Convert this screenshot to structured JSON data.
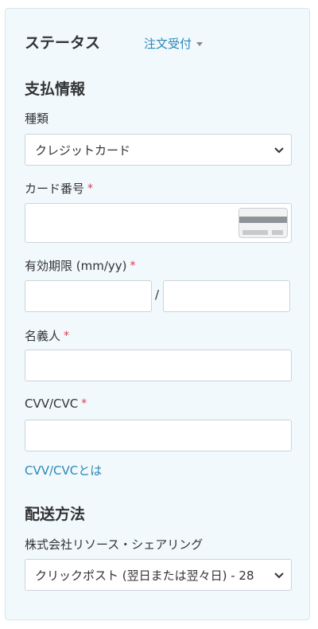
{
  "status": {
    "title": "ステータス",
    "value": "注文受付"
  },
  "payment": {
    "title": "支払情報",
    "type_label": "種類",
    "type_selected": "クレジットカード",
    "card_number_label": "カード番号",
    "expiry_label": "有効期限 (mm/yy)",
    "expiry_separator": "/",
    "holder_label": "名義人",
    "cvv_label": "CVV/CVC",
    "cvv_help_link": "CVV/CVCとは",
    "required_mark": "*"
  },
  "shipping": {
    "title": "配送方法",
    "company": "株式会社リソース・シェアリング",
    "method_selected": "クリックポスト (翌日または翌々日) - 28"
  },
  "colors": {
    "panel_bg": "#f1f9fd",
    "link": "#2a87b7",
    "required": "#e0394f"
  }
}
